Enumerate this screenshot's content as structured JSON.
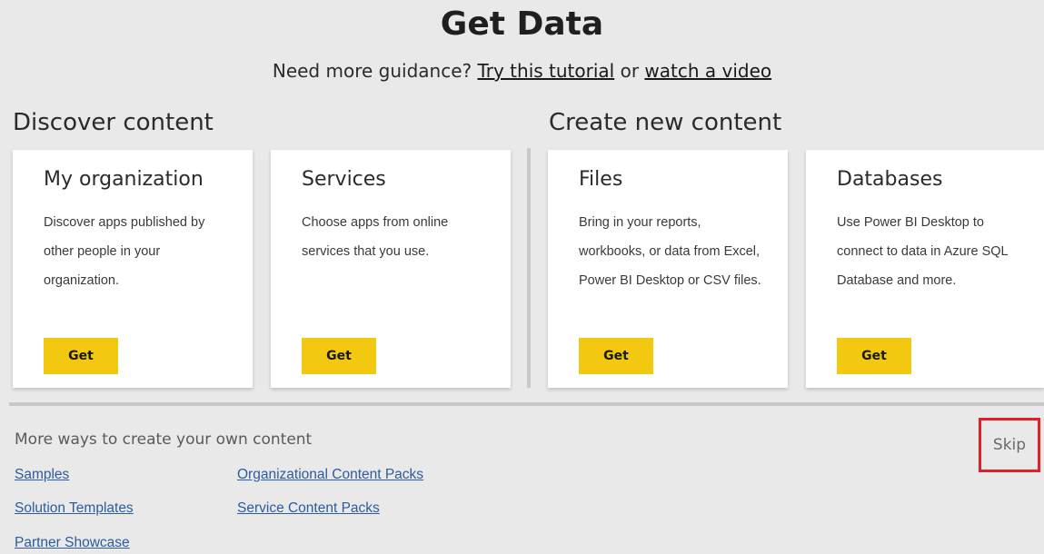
{
  "header": {
    "title": "Get Data",
    "guidance_prefix": "Need more guidance?",
    "tutorial_link": "Try this tutorial",
    "or_text": "or",
    "video_link": "watch a video"
  },
  "sections": {
    "discover": "Discover content",
    "create": "Create new content"
  },
  "cards": [
    {
      "title": "My organization",
      "description": "Discover apps published by other people in your organization.",
      "button": "Get"
    },
    {
      "title": "Services",
      "description": "Choose apps from online services that you use.",
      "button": "Get"
    },
    {
      "title": "Files",
      "description": "Bring in your reports, workbooks, or data from Excel, Power BI Desktop or CSV files.",
      "button": "Get"
    },
    {
      "title": "Databases",
      "description": "Use Power BI Desktop to connect to data in Azure SQL Database and more.",
      "button": "Get"
    }
  ],
  "more": {
    "heading": "More ways to create your own content",
    "links": [
      "Samples",
      "Solution Templates",
      "Partner Showcase",
      "Organizational Content Packs",
      "Service Content Packs"
    ]
  },
  "skip_label": "Skip",
  "colors": {
    "background": "#e9e9e9",
    "button": "#f2c811",
    "link": "#2b5c9e",
    "highlight": "#e0202a"
  }
}
